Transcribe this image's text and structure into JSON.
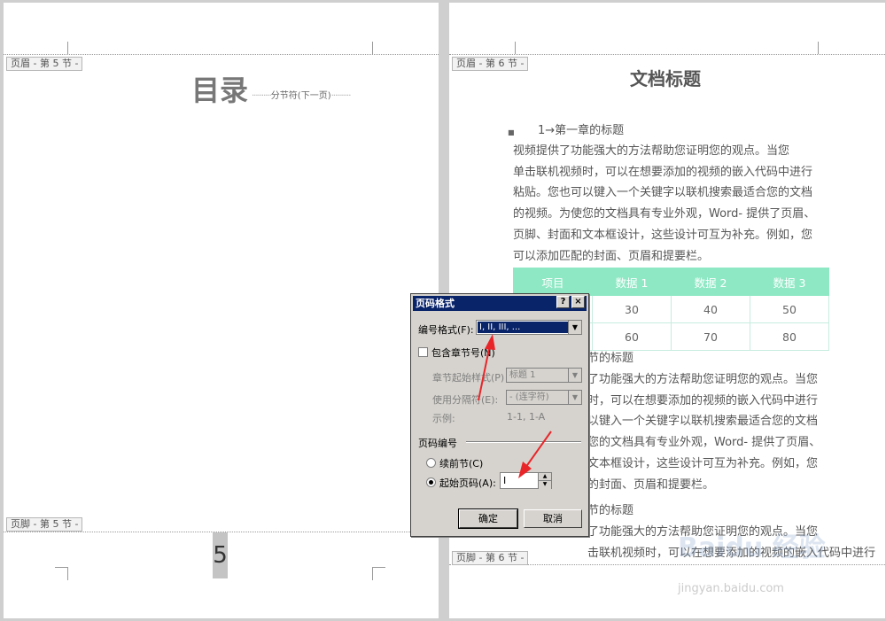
{
  "page5": {
    "header_tag": "页眉 - 第 5 节 -",
    "toc_title": "目录",
    "section_break": "分节符(下一页)",
    "footer_tag": "页脚 - 第 5 节 -",
    "page_number": "5"
  },
  "page6": {
    "header_tag": "页眉 - 第 6 节 -",
    "doc_title": "文档标题",
    "heading1": "1→第一章的标题",
    "para1_lines": [
      "视频提供了功能强大的方法帮助您证明您的观点。当您",
      "单击联机视频时，可以在想要添加的视频的嵌入代码中进行",
      "粘贴。您也可以键入一个关键字以联机搜索最适合您的文档",
      "的视频。为使您的文档具有专业外观，Word- 提供了页眉、",
      "页脚、封面和文本框设计，这些设计可互为补充。例如，您",
      "可以添加匹配的封面、页眉和提要栏。"
    ],
    "table": {
      "headers": [
        "项目",
        "数据 1",
        "数据 2",
        "数据 3"
      ],
      "rows": [
        [
          "",
          "30",
          "40",
          "50"
        ],
        [
          "",
          "60",
          "70",
          "80"
        ]
      ]
    },
    "heading2_visible": "节的标题",
    "para2_lines": [
      "了功能强大的方法帮助您证明您的观点。当您",
      "时，可以在想要添加的视频的嵌入代码中进行",
      "以键入一个关键字以联机搜索最适合您的文档",
      "您的文档具有专业外观，Word- 提供了页眉、",
      "文本框设计，这些设计可互为补充。例如，您",
      "的封面、页眉和提要栏。"
    ],
    "heading3_visible": "节的标题",
    "para3_lines": [
      "了功能强大的方法帮助您证明您的观点。当您",
      "击联机视频时，可以在想要添加的视频的嵌入代码中进行"
    ],
    "footer_tag": "页脚 - 第 6 节 -"
  },
  "dialog": {
    "title": "页码格式",
    "help_btn": "?",
    "close_btn": "×",
    "number_format_label": "编号格式(F):",
    "number_format_value": "I, II, III, ...",
    "include_chapter_label": "包含章节号(N)",
    "chapter_style_label": "章节起始样式(P)",
    "chapter_style_value": "标题 1",
    "separator_label": "使用分隔符(E):",
    "separator_value": "-  (连字符)",
    "example_label": "示例:",
    "example_value": "1-1, 1-A",
    "page_numbering_label": "页码编号",
    "continue_label": "续前节(C)",
    "start_at_label": "起始页码(A):",
    "start_at_value": "I",
    "ok_label": "确定",
    "cancel_label": "取消"
  },
  "watermark": {
    "brand": "Baidu 经验",
    "url": "jingyan.baidu.com"
  },
  "colors": {
    "table_header_bg": "#8ee8c4",
    "dialog_title_bg": "#0a246a",
    "arrow": "#e8262a"
  }
}
